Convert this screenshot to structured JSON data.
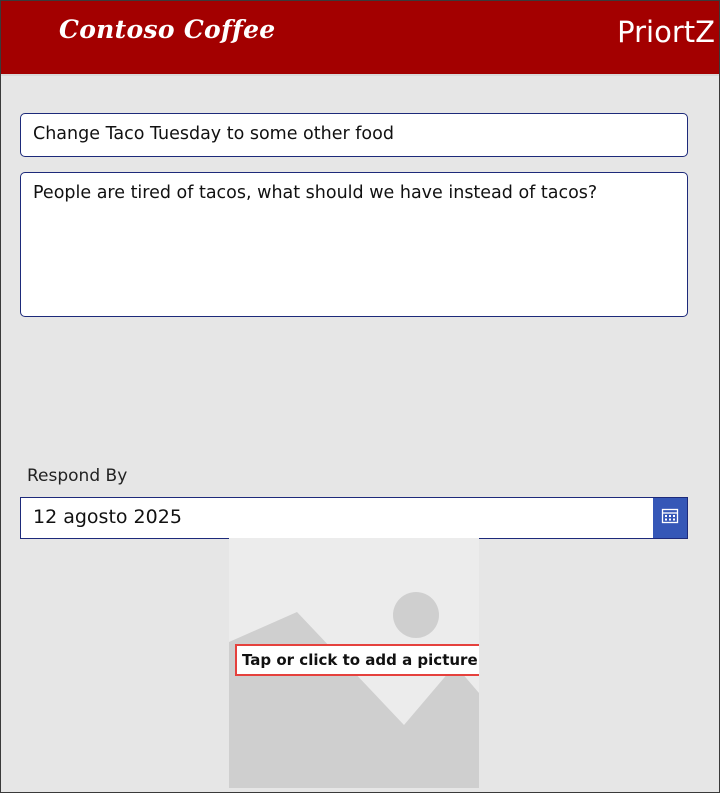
{
  "header": {
    "logo_text": "Contoso Coffee",
    "app_name": "PriortZ",
    "color": "#a30000"
  },
  "form": {
    "title_value": "Change Taco Tuesday to some other food",
    "description_value": "People are tired of tacos, what should we have instead of tacos?",
    "respond_by_label": "Respond By",
    "date_value": "12 agosto 2025",
    "add_picture_label": "Tap or click to add a picture"
  },
  "icons": {
    "calendar": "calendar-icon",
    "image_placeholder": "image-placeholder-icon"
  },
  "colors": {
    "accent": "#3557b7",
    "field_border": "#1d2a7a",
    "highlight": "#e5413d"
  }
}
